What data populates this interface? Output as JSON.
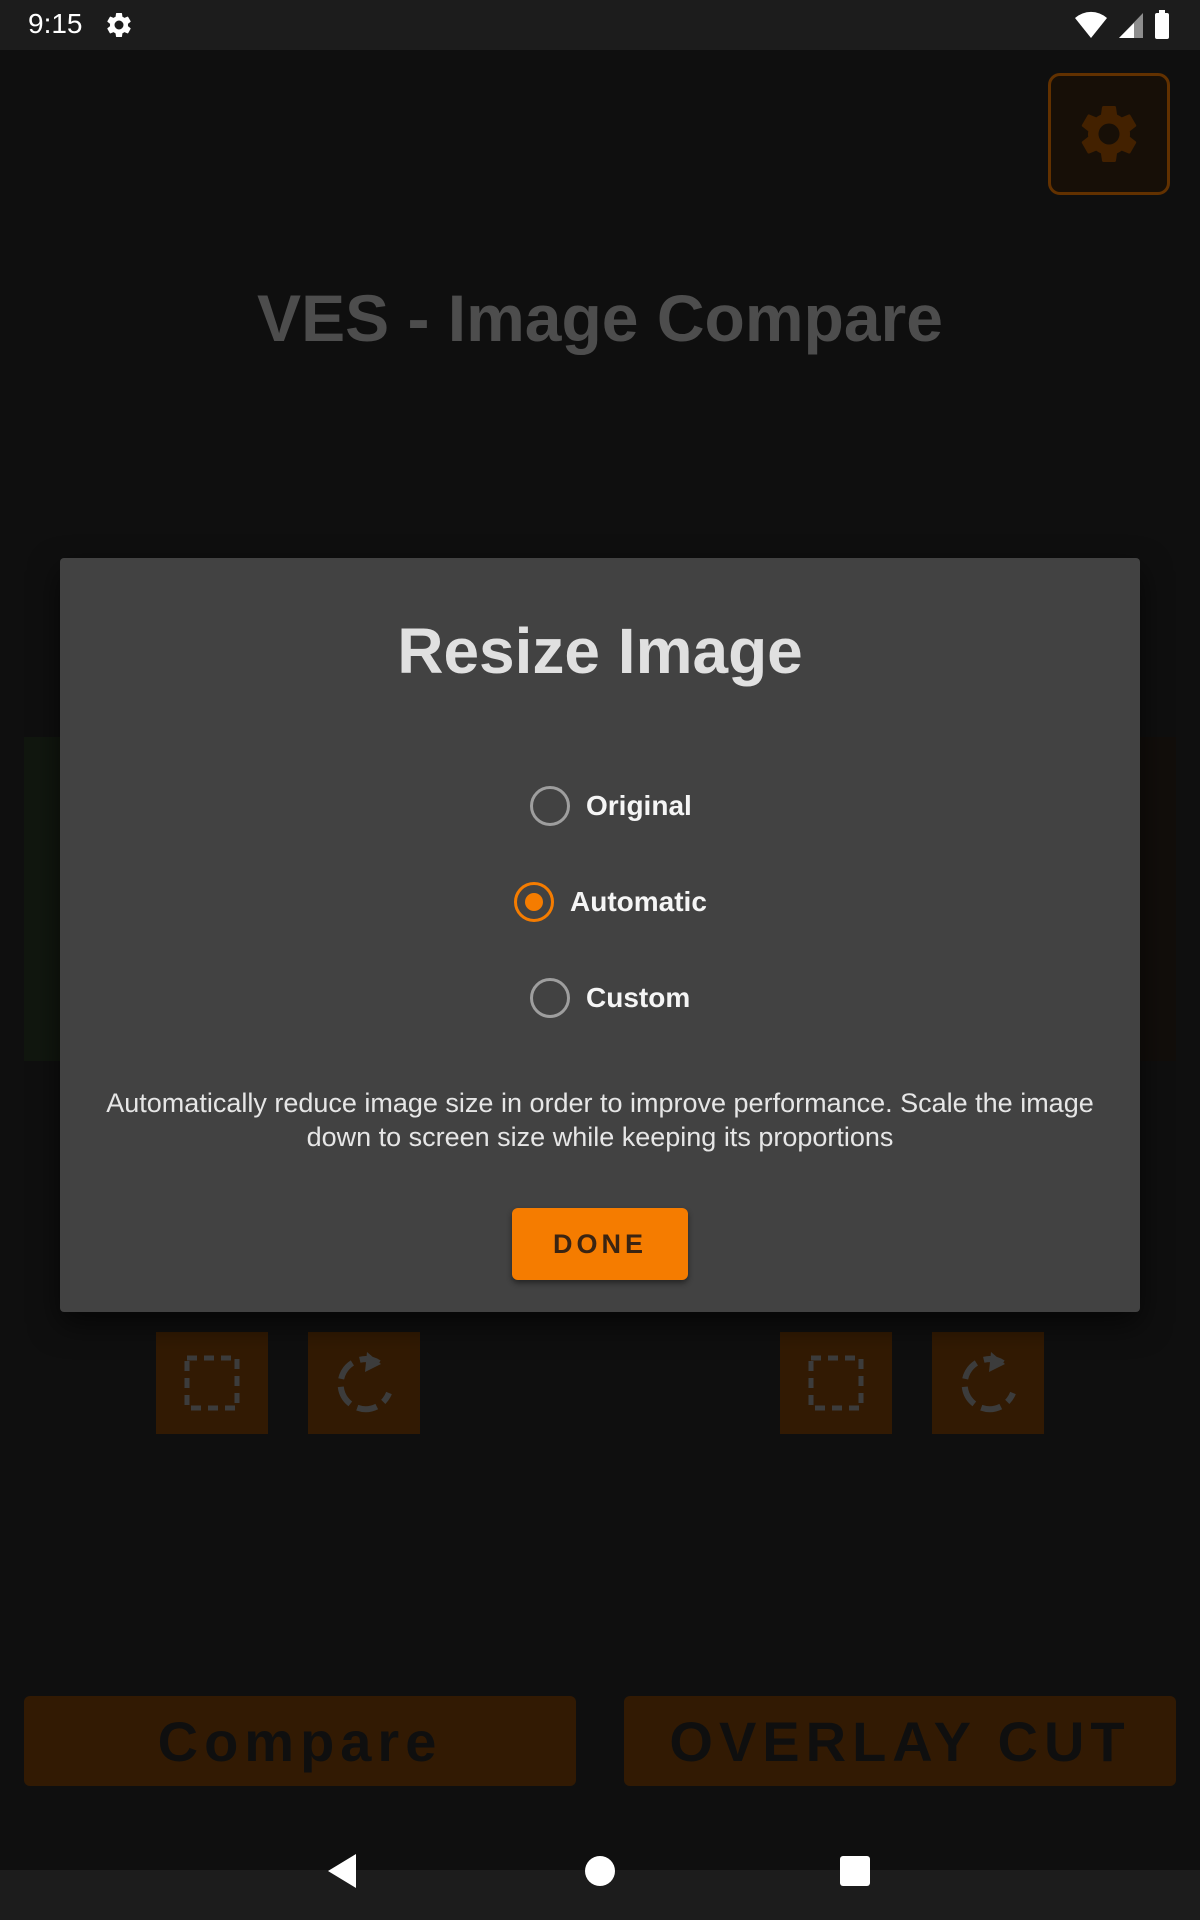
{
  "status_bar": {
    "time": "9:15",
    "icons": [
      "settings-icon",
      "wifi-icon",
      "signal-icon",
      "battery-icon"
    ]
  },
  "app": {
    "title": "VES - Image Compare",
    "settings_icon": "gear-icon",
    "left_tools": [
      "crop-icon",
      "rotate-icon"
    ],
    "right_tools": [
      "crop-icon",
      "rotate-icon"
    ],
    "compare_label": "Compare",
    "overlay_cut_label": "OVERLAY CUT"
  },
  "dialog": {
    "title": "Resize Image",
    "options": [
      {
        "label": "Original",
        "checked": false
      },
      {
        "label": "Automatic",
        "checked": true
      },
      {
        "label": "Custom",
        "checked": false
      }
    ],
    "description": "Automatically reduce image size in order to improve performance. Scale the image down to screen size while keeping its proportions",
    "done_label": "DONE"
  },
  "nav_bar": {
    "icons": [
      "back-icon",
      "home-icon",
      "recents-icon"
    ]
  },
  "colors": {
    "accent": "#f57c00",
    "background": "#1c1c1c",
    "dialog": "#424242"
  }
}
